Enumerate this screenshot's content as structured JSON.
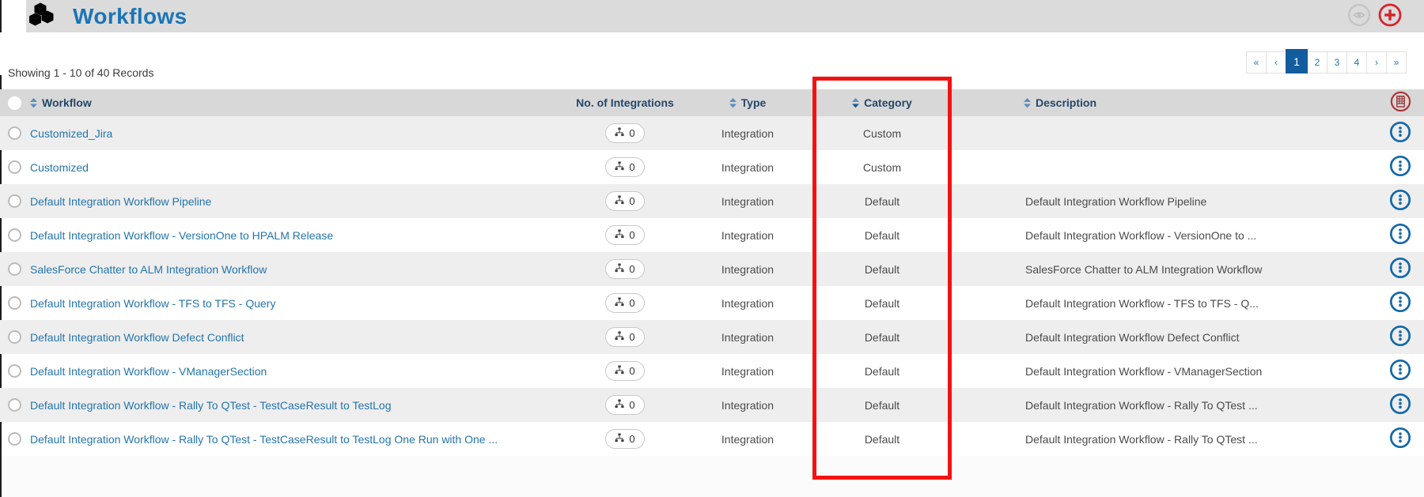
{
  "header": {
    "title": "Workflows",
    "icon": "cubes-icon"
  },
  "toolbar": {
    "view_button": "eye-icon",
    "add_button": "plus-circle-icon"
  },
  "status": {
    "showing_text": "Showing 1 - 10 of 40 Records"
  },
  "pagination": {
    "items": [
      {
        "label": "«"
      },
      {
        "label": "‹"
      },
      {
        "label": "1",
        "active": true
      },
      {
        "label": "2"
      },
      {
        "label": "3"
      },
      {
        "label": "4"
      },
      {
        "label": "›"
      },
      {
        "label": "»"
      }
    ]
  },
  "table": {
    "columns": [
      {
        "label": "Workflow",
        "sortable": true
      },
      {
        "label": "No. of Integrations",
        "sortable": false
      },
      {
        "label": "Type",
        "sortable": true
      },
      {
        "label": "Category",
        "sortable": true,
        "sorted": true
      },
      {
        "label": "Description",
        "sortable": true
      }
    ],
    "rows": [
      {
        "workflow": "Customized_Jira",
        "integrations": "0",
        "type": "Integration",
        "category": "Custom",
        "description": ""
      },
      {
        "workflow": "Customized",
        "integrations": "0",
        "type": "Integration",
        "category": "Custom",
        "description": ""
      },
      {
        "workflow": "Default Integration Workflow Pipeline",
        "integrations": "0",
        "type": "Integration",
        "category": "Default",
        "description": "Default Integration Workflow Pipeline"
      },
      {
        "workflow": "Default Integration Workflow - VersionOne to HPALM Release",
        "integrations": "0",
        "type": "Integration",
        "category": "Default",
        "description": "Default Integration Workflow - VersionOne to ..."
      },
      {
        "workflow": "SalesForce Chatter to ALM Integration Workflow",
        "integrations": "0",
        "type": "Integration",
        "category": "Default",
        "description": "SalesForce Chatter to ALM Integration Workflow"
      },
      {
        "workflow": "Default Integration Workflow - TFS to TFS - Query",
        "integrations": "0",
        "type": "Integration",
        "category": "Default",
        "description": "Default Integration Workflow - TFS to TFS - Q..."
      },
      {
        "workflow": "Default Integration Workflow Defect Conflict",
        "integrations": "0",
        "type": "Integration",
        "category": "Default",
        "description": "Default Integration Workflow Defect Conflict"
      },
      {
        "workflow": "Default Integration Workflow - VManagerSection",
        "integrations": "0",
        "type": "Integration",
        "category": "Default",
        "description": "Default Integration Workflow - VManagerSection"
      },
      {
        "workflow": "Default Integration Workflow - Rally To QTest - TestCaseResult to TestLog",
        "integrations": "0",
        "type": "Integration",
        "category": "Default",
        "description": "Default Integration Workflow - Rally To QTest ..."
      },
      {
        "workflow": "Default Integration Workflow - Rally To QTest - TestCaseResult to TestLog One Run with One ...",
        "integrations": "0",
        "type": "Integration",
        "category": "Default",
        "description": "Default Integration Workflow - Rally To QTest ..."
      }
    ],
    "row_icons": {
      "integrations_badge": "sitemap-icon",
      "actions": "kebab-circle-icon",
      "column_tool": "table-circle-icon"
    }
  },
  "annotation": {
    "name": "category-column-highlight",
    "color": "#f31212"
  },
  "colors": {
    "title_blue": "#1b75b7",
    "link_blue": "#2575ac",
    "brand_red": "#e01e25",
    "active_page_bg": "#135c9d",
    "info_icon_blue": "#1268a8",
    "header_text": "#25476a"
  }
}
